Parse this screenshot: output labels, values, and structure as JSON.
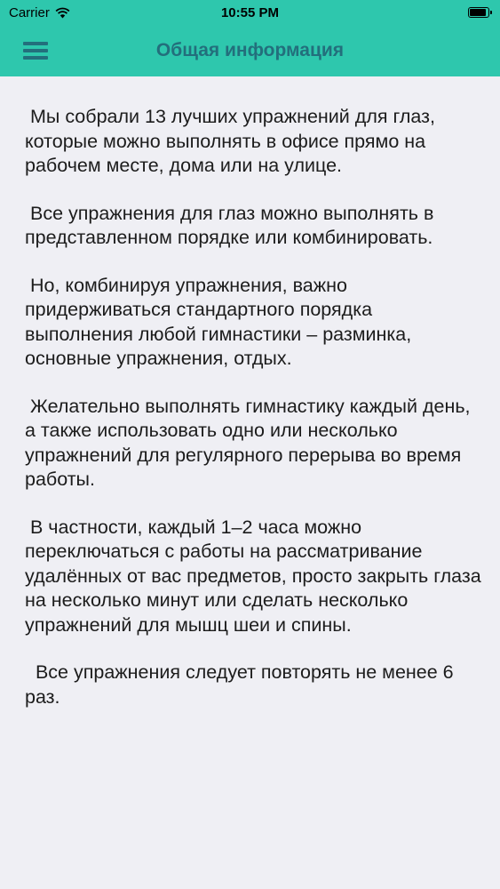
{
  "status_bar": {
    "carrier": "Carrier",
    "time": "10:55 PM",
    "wifi_icon": "wifi-icon",
    "battery_icon": "battery-icon"
  },
  "nav": {
    "menu_icon": "hamburger-menu-icon",
    "title": "Общая информация"
  },
  "content": {
    "paragraphs": [
      " Мы собрали 13 лучших упражнений для глаз, которые можно выполнять в офисе прямо на рабочем месте, дома или на улице.",
      " Все упражнения для глаз можно выполнять в представленном порядке или комбинировать.",
      " Но, комбинируя упражнения, важно придерживаться стандартного порядка выполнения любой гимнастики – разминка, основные упражнения, отдых.",
      " Желательно выполнять гимнастику каждый день, а также использовать одно или несколько упражнений для регулярного перерыва во время работы.",
      " В частности, каждый 1–2 часа можно переключаться с работы на рассматривание удалённых от вас предметов, просто закрыть глаза на несколько минут или сделать несколько упражнений для мышц шеи и спины.",
      "  Все упражнения следует повторять не менее 6 раз."
    ]
  },
  "colors": {
    "header": "#2ec7ad",
    "header_text": "#236f7c",
    "background": "#efeff4",
    "text": "#1c1c1c"
  }
}
